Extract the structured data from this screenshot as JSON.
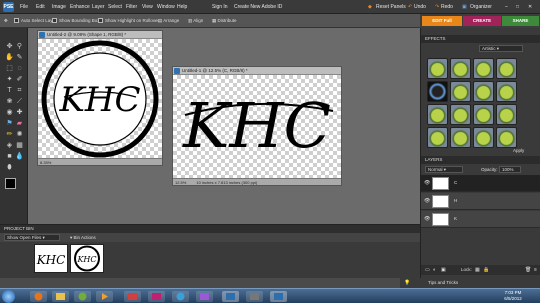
{
  "app": {
    "logo": "PSE"
  },
  "menubar": {
    "items": [
      "File",
      "Edit",
      "Image",
      "Enhance",
      "Layer",
      "Select",
      "Filter",
      "View",
      "Window",
      "Help"
    ],
    "sign_in": "Sign In",
    "create_id": "Create New Adobe ID",
    "reset_panels": "Reset Panels",
    "undo": "Undo",
    "redo": "Redo",
    "organizer": "Organizer"
  },
  "options_bar": {
    "auto_select": "Auto Select Layer",
    "bounding_box": "Show Bounding Box",
    "highlight": "Show Highlight on Rollover",
    "arrange": "Arrange",
    "align": "Align",
    "distribute": "Distribute"
  },
  "modes": {
    "edit": "EDIT Full",
    "create": "CREATE",
    "share": "SHARE"
  },
  "documents": [
    {
      "title": "Untitled-2 @ 9.09% (Shape 1, RGB/8) *",
      "status": "8.33%",
      "monogram": "KHC"
    },
    {
      "title": "Untitled-1 @ 12.5% (C, RGB/8) *",
      "zoom": "12.5%",
      "size": "10 inches x 7.813 inches (300 ppi)",
      "monogram": "KHC"
    }
  ],
  "project_bin": {
    "header": "PROJECT BIN",
    "show": "Show Open Files",
    "actions": "Bin Actions"
  },
  "effects": {
    "header": "EFFECTS",
    "filter": "Artistic",
    "apply": "Apply"
  },
  "layers": {
    "header": "LAYERS",
    "blend": "Normal",
    "opacity_label": "Opacity:",
    "opacity": "100%",
    "lock_label": "Lock:",
    "items": [
      {
        "name": "C"
      },
      {
        "name": "H"
      },
      {
        "name": "K"
      }
    ]
  },
  "tips": "Tips and Tricks",
  "clock": {
    "time": "7:03 PM",
    "date": "6/5/2012"
  },
  "colors": {
    "edit": "#e8861a",
    "create": "#a0245a",
    "share": "#3d8a3a",
    "taskbar": "#2c4a6e"
  }
}
